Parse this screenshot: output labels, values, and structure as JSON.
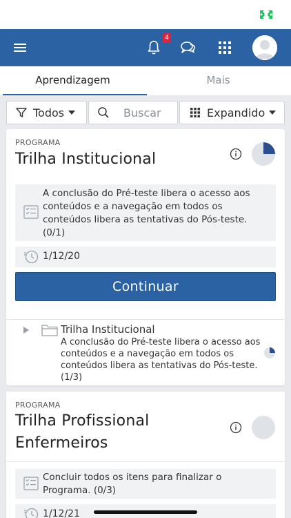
{
  "header": {
    "notification_count": "4",
    "icons": [
      "menu-icon",
      "bell-icon",
      "chat-icon",
      "apps-grid-icon",
      "avatar"
    ]
  },
  "tabs": [
    {
      "label": "Aprendizagem",
      "active": true
    },
    {
      "label": "Mais",
      "active": false
    }
  ],
  "filters": {
    "filter_label": "Todos",
    "search_placeholder": "Buscar",
    "view_label": "Expandido"
  },
  "cards": [
    {
      "kicker": "PROGRAMA",
      "title": "Trilha Institucional",
      "progress": 0.25,
      "note": "A conclusão do Pré-teste libera o acesso aos conteúdos e a navegação em todos os conteúdos libera as tentativas do Pós-teste. (0/1)",
      "date": "1/12/20",
      "button_label": "Continuar",
      "child": {
        "title": "Trilha Institucional",
        "desc": "A conclusão do Pré-teste libera o acesso aos conteúdos e a navegação em todos os conteúdos libera as tentativas do Pós-teste. (1/3)",
        "progress": 0.25
      }
    },
    {
      "kicker": "PROGRAMA",
      "title_line1": "Trilha Profissional",
      "title_line2": "Enfermeiros",
      "progress": 0,
      "note": "Concluir todos os itens para finalizar o Programa. (0/3)",
      "date": "1/12/21"
    }
  ],
  "colors": {
    "primary": "#2a62a4",
    "background": "#e9eaed",
    "badge": "#d7263d"
  }
}
